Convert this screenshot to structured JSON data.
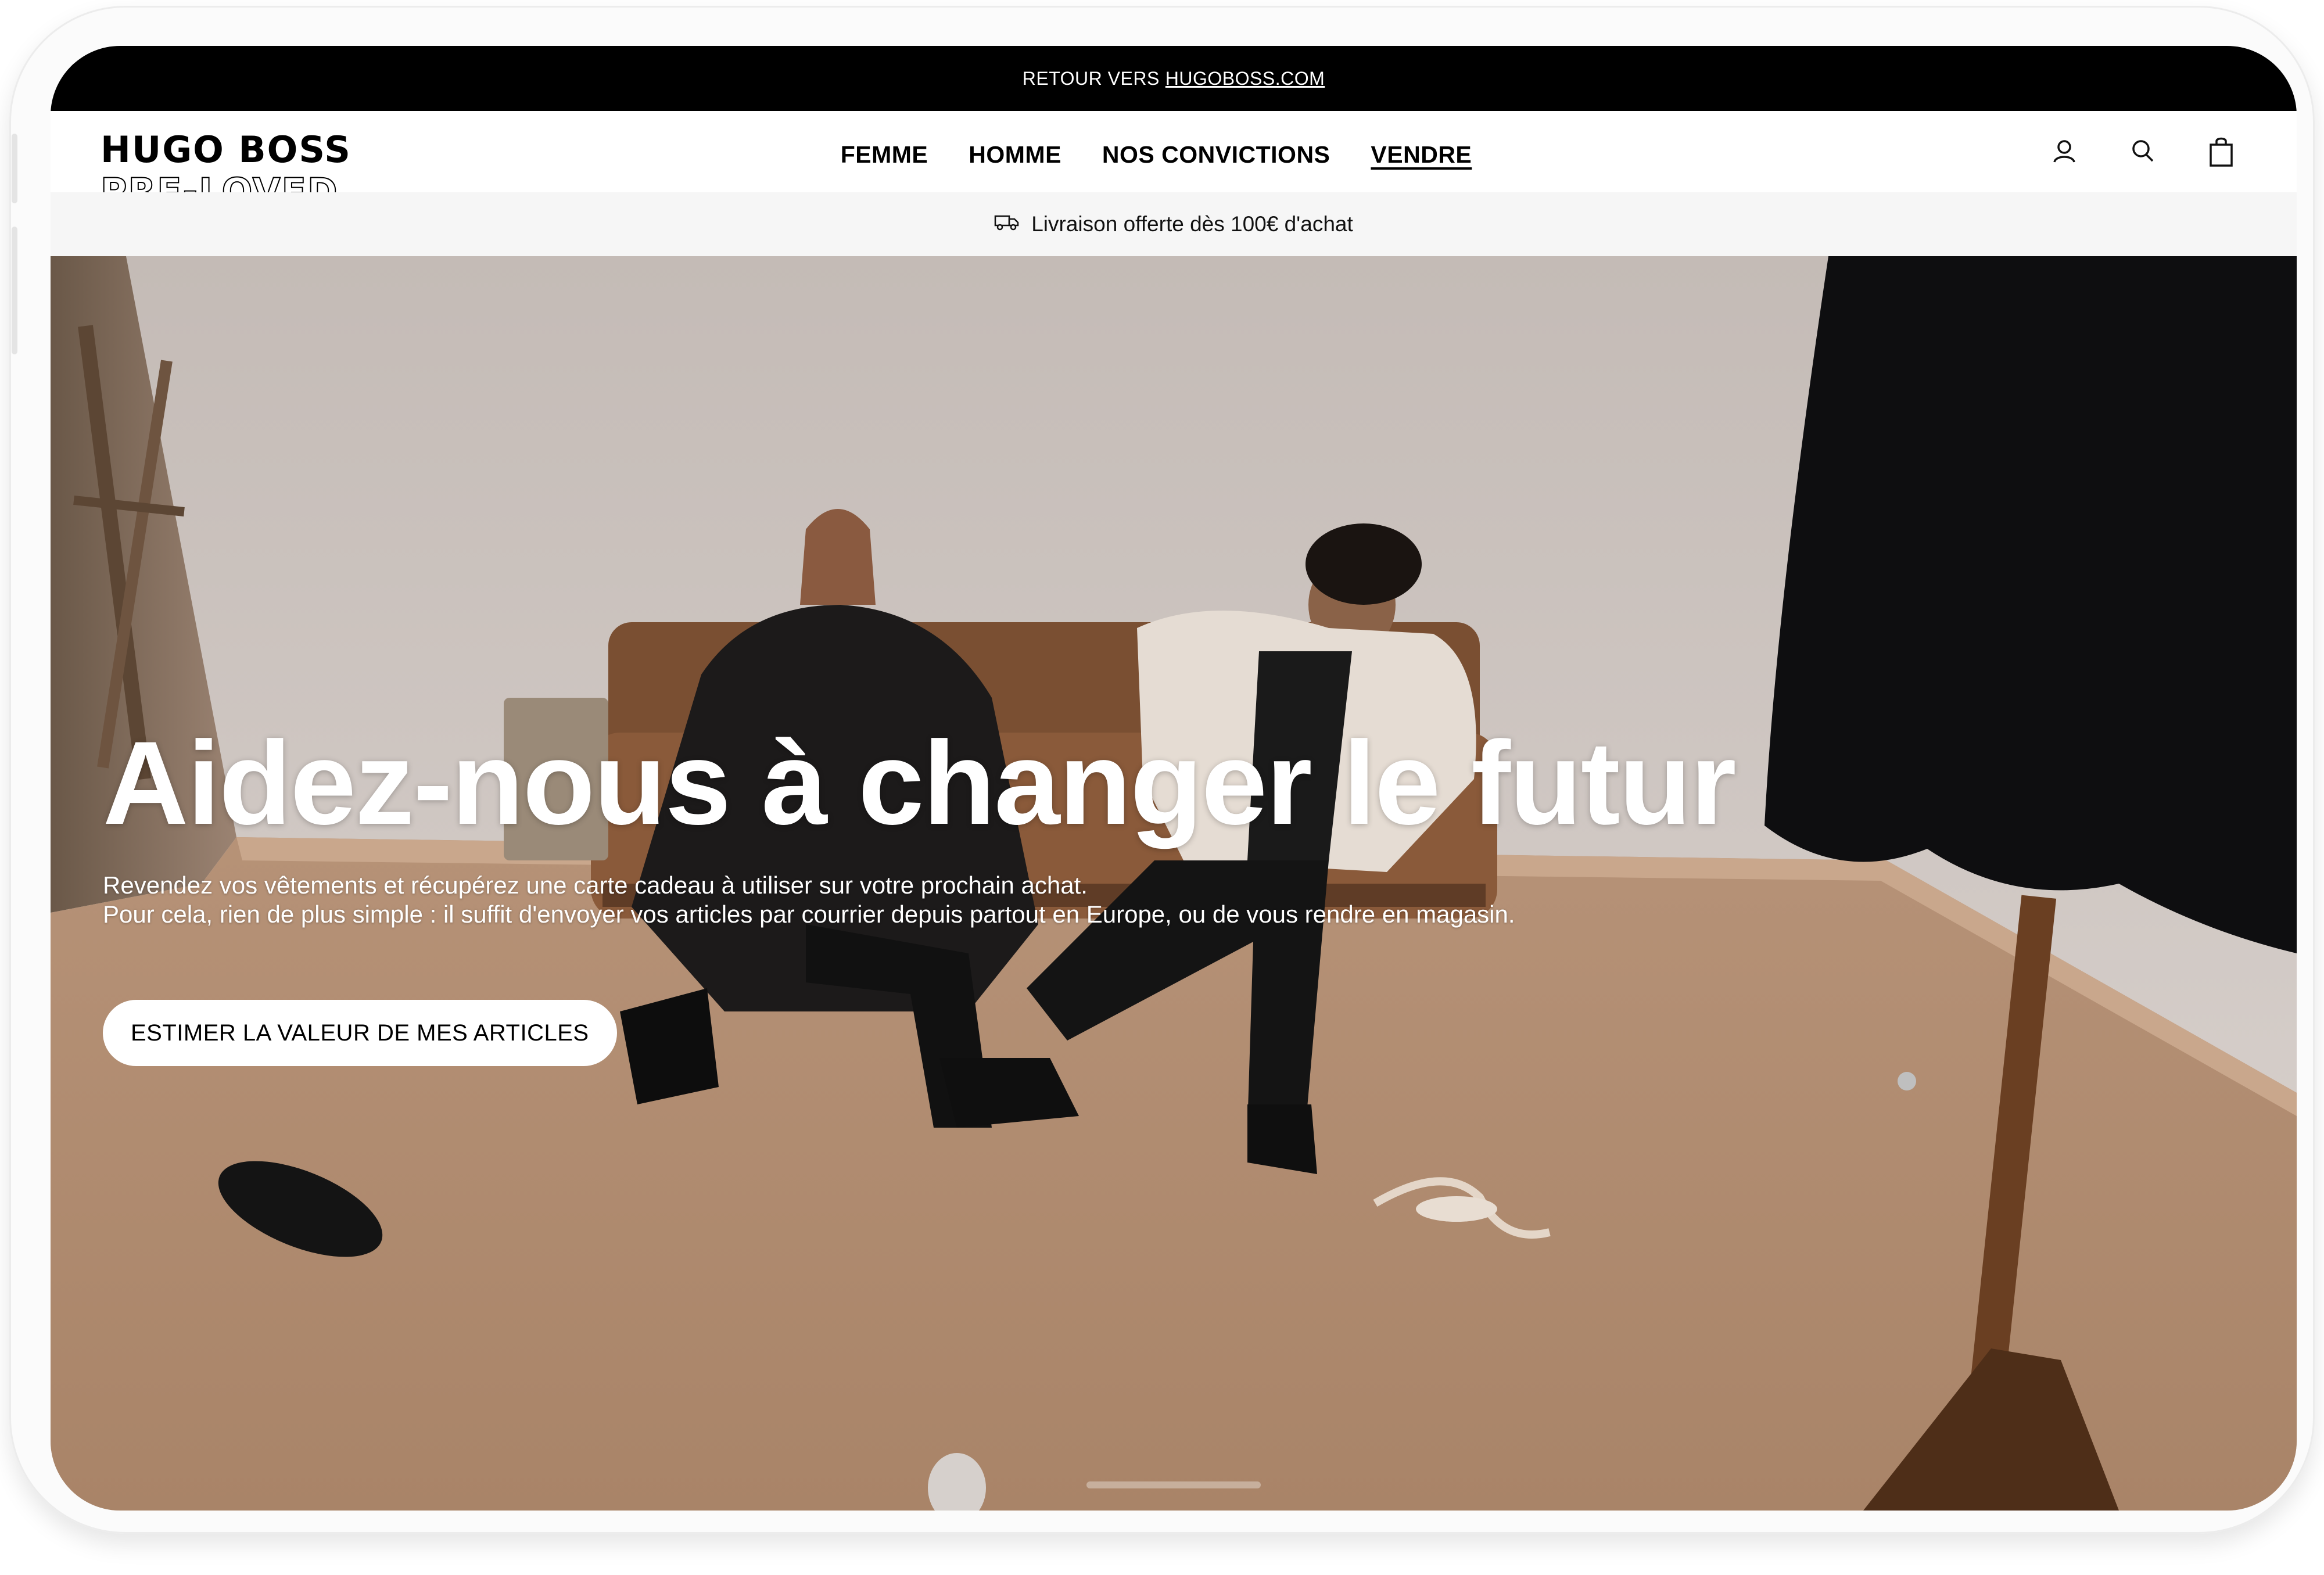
{
  "top_bar": {
    "prefix": "RETOUR VERS",
    "link": "HUGOBOSS.COM"
  },
  "header": {
    "logo_main": "HUGO BOSS",
    "logo_sub": "PRE-LOVED",
    "nav": [
      {
        "label": "FEMME"
      },
      {
        "label": "HOMME"
      },
      {
        "label": "NOS CONVICTIONS"
      },
      {
        "label": "VENDRE",
        "active": true
      }
    ],
    "icons": [
      "account-icon",
      "search-icon",
      "shopping-bag-icon"
    ]
  },
  "shipping": {
    "icon": "delivery-truck-icon",
    "text": "Livraison offerte dès 100€ d'achat"
  },
  "hero": {
    "title": "Aidez-nous à changer le futur",
    "text_line_1": "Revendez vos vêtements et récupérez une carte cadeau à utiliser sur votre prochain achat.",
    "text_line_2": "Pour cela, rien de plus simple : il suffit d'envoyer vos articles par courrier depuis partout en Europe, ou de vous rendre en magasin.",
    "cta": "ESTIMER LA VALEUR DE MES ARTICLES"
  },
  "colors": {
    "top_bar_bg": "#000000",
    "shipping_bg": "#f6f6f6",
    "hero_floor": "#b08a70"
  }
}
